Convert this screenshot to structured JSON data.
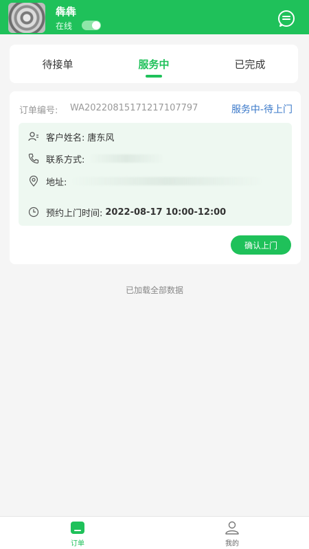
{
  "header": {
    "username": "犇犇",
    "status_label": "在线",
    "online": true
  },
  "tabs": [
    {
      "label": "待接单",
      "active": false
    },
    {
      "label": "服务中",
      "active": true
    },
    {
      "label": "已完成",
      "active": false
    }
  ],
  "order": {
    "number_label": "订单编号:",
    "number_value": "WA20220815171217107797",
    "status": "服务中-待上门",
    "customer_label": "客户姓名:",
    "customer_value": "唐东风",
    "contact_label": "联系方式:",
    "address_label": "地址:",
    "appointment_label": "预约上门时间:",
    "appointment_value": "2022-08-17 10:00-12:00",
    "confirm_button": "确认上门"
  },
  "list_footer": "已加载全部数据",
  "bottom_nav": {
    "orders_label": "订单",
    "mine_label": "我的"
  },
  "colors": {
    "brand_green": "#1fc15a",
    "status_blue": "#3a78c9"
  },
  "icons": [
    "chat-icon",
    "user-icon",
    "phone-icon",
    "location-icon",
    "clock-icon",
    "orders-icon",
    "profile-icon"
  ]
}
